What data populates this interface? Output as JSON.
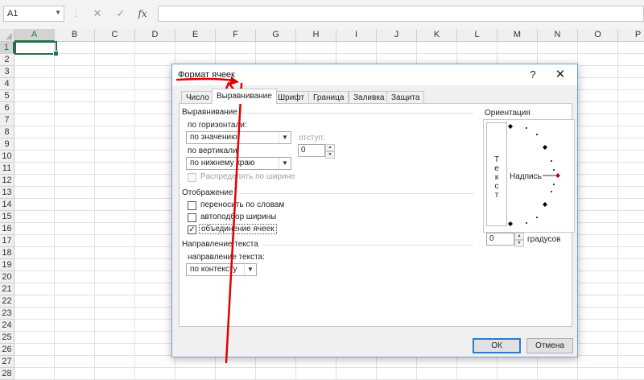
{
  "formula_bar": {
    "name_box": "A1",
    "cancel_glyph": "✕",
    "enter_glyph": "✓",
    "fx_label": "fx",
    "formula": ""
  },
  "sheet": {
    "columns": [
      "A",
      "B",
      "C",
      "D",
      "E",
      "F",
      "G",
      "H",
      "I",
      "J",
      "K",
      "L",
      "M",
      "N",
      "O",
      "P"
    ],
    "rows": [
      "1",
      "2",
      "3",
      "4",
      "5",
      "6",
      "7",
      "8",
      "9",
      "10",
      "11",
      "12",
      "13",
      "14",
      "15",
      "16",
      "17",
      "18",
      "19",
      "20",
      "21",
      "22",
      "23",
      "24",
      "25",
      "26",
      "27",
      "28"
    ],
    "selected_cell": "A1",
    "accent_color": "#217346"
  },
  "dialog": {
    "title": "Формат ячеек",
    "help": "?",
    "close": "✕",
    "tabs": [
      {
        "label": "Число"
      },
      {
        "label": "Выравнивание"
      },
      {
        "label": "Шрифт"
      },
      {
        "label": "Граница"
      },
      {
        "label": "Заливка"
      },
      {
        "label": "Защита"
      }
    ],
    "active_tab": "Выравнивание",
    "alignment": {
      "group_title": "Выравнивание",
      "horizontal_label": "по горизонтали:",
      "horizontal_value": "по значению",
      "indent_label": "отступ:",
      "indent_value": "0",
      "vertical_label": "по вертикали:",
      "vertical_value": "по нижнему краю",
      "distribute_label": "Распределять по ширине",
      "distribute_checked": false
    },
    "display": {
      "group_title": "Отображение",
      "wrap_label": "переносить по словам",
      "wrap_checked": false,
      "shrink_label": "автоподбор ширины",
      "shrink_checked": false,
      "merge_label": "объединение ячеек",
      "merge_checked": true
    },
    "direction": {
      "group_title": "Направление текста",
      "direction_label": "направление текста:",
      "direction_value": "по контексту"
    },
    "orientation": {
      "group_title": "Ориентация",
      "vertical_text": [
        "Т",
        "е",
        "к",
        "с",
        "т"
      ],
      "dial_label": "Надпись",
      "degrees_value": "0",
      "degrees_label": "градусов"
    },
    "ok_label": "ОК",
    "cancel_label": "Отмена"
  },
  "annotation_color": "#e00000"
}
